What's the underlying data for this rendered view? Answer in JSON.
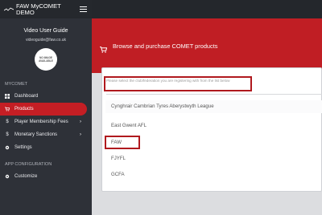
{
  "app": {
    "brand": "FAW MyCOMET DEMO"
  },
  "user": {
    "name": "Video User Guide",
    "email": "videoguide@faw.co.uk",
    "avatar_text": "NO IMAGE AVAILABLE"
  },
  "sidebar": {
    "section_mycomet": "MYCOMET",
    "items": [
      {
        "label": "Dashboard",
        "icon": "grid-icon",
        "active": false,
        "has_children": false
      },
      {
        "label": "Products",
        "icon": "cart-icon",
        "active": true,
        "has_children": false
      },
      {
        "label": "Player Membership Fees",
        "icon": "dollar-icon",
        "active": false,
        "has_children": true
      },
      {
        "label": "Monetary Sanctions",
        "icon": "dollar-icon",
        "active": false,
        "has_children": true
      },
      {
        "label": "Settings",
        "icon": "gear-icon",
        "active": false,
        "has_children": false
      }
    ],
    "section_app_config": "APP CONFIGURATION",
    "config_items": [
      {
        "label": "Customize",
        "icon": "gear-icon"
      }
    ]
  },
  "banner": {
    "title": "Browse and purchase COMET products",
    "icon": "cart-icon"
  },
  "form": {
    "hint": "Please select the club/federation you are registering with from the list below",
    "options": [
      "Cynghrair Cambrian Tyres Aberystwyth League",
      "East Gwent AFL",
      "FAW",
      "FJYFL",
      "GCFA"
    ],
    "highlighted_option": "FAW"
  },
  "colors": {
    "accent_red": "#c01e24",
    "sidebar_bg": "#2e3138",
    "topbar_bg": "#24272c"
  }
}
